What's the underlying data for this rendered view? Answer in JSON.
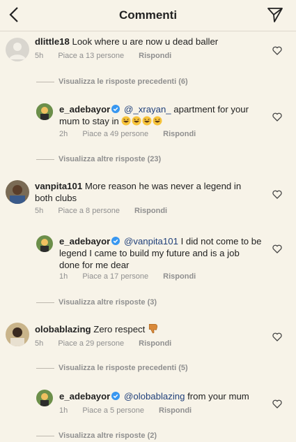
{
  "header": {
    "title": "Commenti"
  },
  "comments": [
    {
      "user": "dlittle18",
      "text": "Look where u are now u dead baller",
      "time": "5h",
      "likes": "Piace a 13 persone",
      "reply": "Rispondi",
      "thread": "Visualizza le risposte precedenti (6)"
    },
    {
      "user": "e_adebayor",
      "mention": "@_xrayan_",
      "text": " apartment for your",
      "text2": "mum to stay in",
      "emojis": [
        "laughing-emoji",
        "laughing-emoji",
        "laughing-emoji",
        "laughing-emoji"
      ],
      "time": "2h",
      "likes": "Piace a 49 persone",
      "reply": "Rispondi",
      "thread": "Visualizza altre risposte (23)"
    },
    {
      "user": "vanpita101",
      "text": "More reason he was never a legend in",
      "text2": "both clubs",
      "time": "5h",
      "likes": "Piace a 8 persone",
      "reply": "Rispondi"
    },
    {
      "user": "e_adebayor",
      "mention": "@vanpita101",
      "text": " I did not come to be",
      "text2": "legend I came to build my future and is a job",
      "text3": "done for me dear",
      "time": "1h",
      "likes": "Piace a 17 persone",
      "reply": "Rispondi",
      "thread": "Visualizza altre risposte (3)"
    },
    {
      "user": "olobablazing",
      "text": "Zero respect",
      "time": "5h",
      "likes": "Piace a 29 persone",
      "reply": "Rispondi",
      "thread": "Visualizza le risposte precedenti (5)"
    },
    {
      "user": "e_adebayor",
      "mention": "@olobablazing",
      "text": " from your mum",
      "time": "1h",
      "likes": "Piace a 5 persone",
      "reply": "Rispondi",
      "thread": "Visualizza altre risposte (2)"
    }
  ],
  "colors": {
    "background": "#f7f3e8",
    "mention": "#1f3f7a",
    "verified": "#3897f0"
  }
}
